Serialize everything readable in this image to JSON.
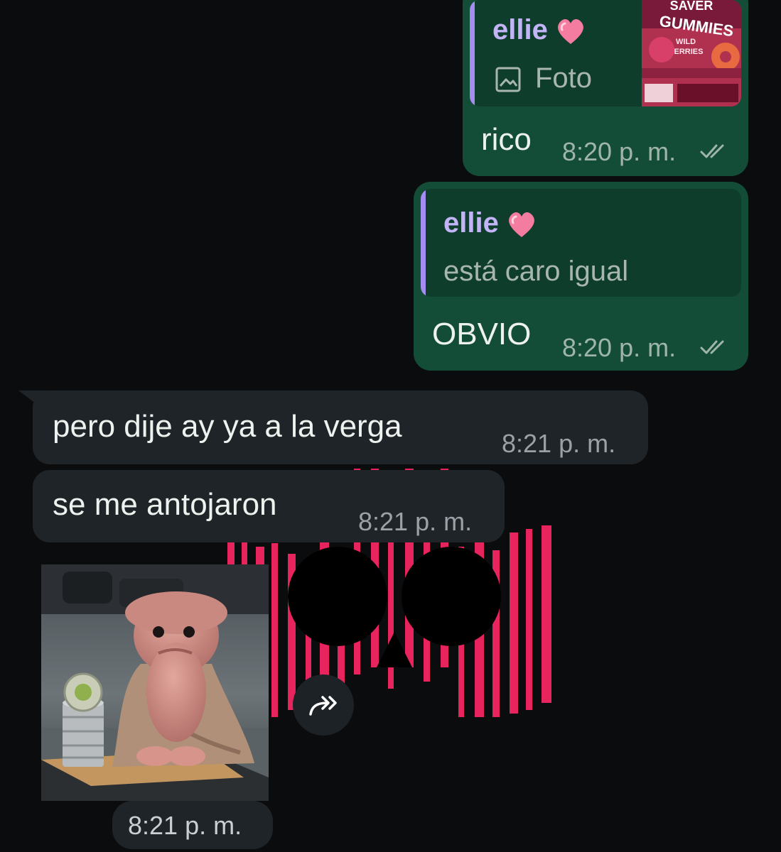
{
  "messages": [
    {
      "direction": "outgoing",
      "reply": {
        "author": "ellie",
        "author_emoji": "pink-heart",
        "type_label": "Foto",
        "type_icon": "image-icon",
        "thumbnail": {
          "brand": "SAVER",
          "product": "GUMMIES",
          "flavor_line1": "WILD",
          "flavor_line2": "BERRIES"
        }
      },
      "text": "rico",
      "time": "8:20 p. m.",
      "status": "read-double-check"
    },
    {
      "direction": "outgoing",
      "reply": {
        "author": "ellie",
        "author_emoji": "pink-heart",
        "text": "está caro igual"
      },
      "text": "OBVIO",
      "time": "8:20 p. m.",
      "status": "read-double-check"
    },
    {
      "direction": "incoming",
      "text": "pero dije ay ya a la verga",
      "time": "8:21 p. m."
    },
    {
      "direction": "incoming",
      "text": "se me antojaron",
      "time": "8:21 p. m."
    },
    {
      "direction": "incoming",
      "type": "image",
      "time": "8:21 p. m."
    }
  ],
  "colors": {
    "background": "#0b0c0d",
    "outgoing_bubble": "#134d37",
    "quote_background": "#0f3d2c",
    "quote_accent": "#a58cf0",
    "quote_author": "#c3b4f7",
    "incoming_bubble": "#1f2428",
    "sticker_pink": "#e8245e"
  },
  "icons": {
    "forward": "forward-icon",
    "image": "image-icon",
    "read": "double-check-icon"
  }
}
